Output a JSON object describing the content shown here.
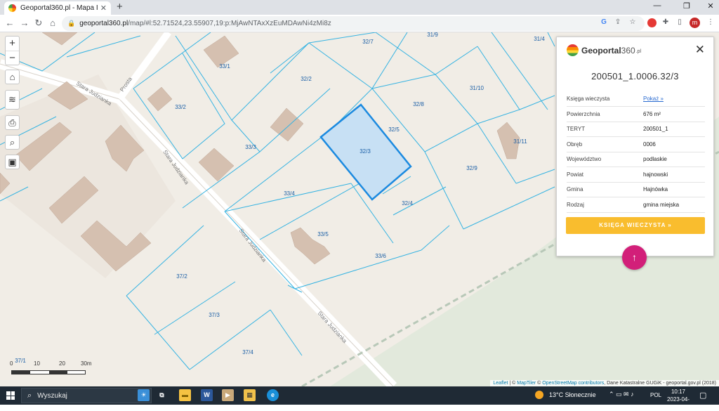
{
  "browser": {
    "tab_title": "Geoportal360.pl - Mapa Interakt",
    "url_domain": "geoportal360.pl",
    "url_path": "/map/#l:52.71524,23.55907,19:p:MjAwNTAxXzEuMDAwNi4zMi8z",
    "avatar_letter": "m"
  },
  "map": {
    "parcels": [
      "32/7",
      "31/9",
      "31/4",
      "33/1",
      "32/2",
      "32/8",
      "31/10",
      "33/2",
      "32/5",
      "33/3",
      "32/3",
      "31/11",
      "32/9",
      "33/4",
      "32/4",
      "33/5",
      "33/6",
      "37/2",
      "37/3",
      "37/4",
      "37/1"
    ],
    "streets": [
      "Stara Judzianka",
      "Stara Judzianka",
      "Stara Judzianka",
      "Stara Judzianka",
      "Prosta"
    ],
    "scale_labels": [
      "0",
      "10",
      "20",
      "30m"
    ],
    "attribution": {
      "leaflet": "Leaflet",
      "sep": " | © ",
      "maptiler": "MapTiler",
      "osm_pre": " © ",
      "osm": "OpenStreetMap contributors",
      "rest": ", Dane Katastralne GUGiK - geoportal.gov.pl (2018)"
    },
    "highlight_color": "#1b8ae0"
  },
  "panel": {
    "logo_text": "Geoportal",
    "logo_num": "360",
    "logo_pl": ".pl",
    "parcel_id": "200501_1.0006.32/3",
    "rows": [
      {
        "label": "Księga wieczysta",
        "value": "Pokaż »"
      },
      {
        "label": "Powierzchnia",
        "value": "676 m²"
      },
      {
        "label": "TERYT",
        "value": "200501_1"
      },
      {
        "label": "Obręb",
        "value": "0006"
      },
      {
        "label": "Województwo",
        "value": "podlaskie"
      },
      {
        "label": "Powiat",
        "value": "hajnowski"
      },
      {
        "label": "Gmina",
        "value": "Hajnówka"
      },
      {
        "label": "Rodzaj",
        "value": "gmina miejska"
      }
    ],
    "button_label": "KSIĘGA WIECZYSTA »",
    "up_arrow": "↑"
  },
  "taskbar": {
    "search_placeholder": "Wyszukaj",
    "weather": "13°C  Słonecznie",
    "lang": "POL",
    "time": "10:17",
    "date": "2023-04-20"
  }
}
